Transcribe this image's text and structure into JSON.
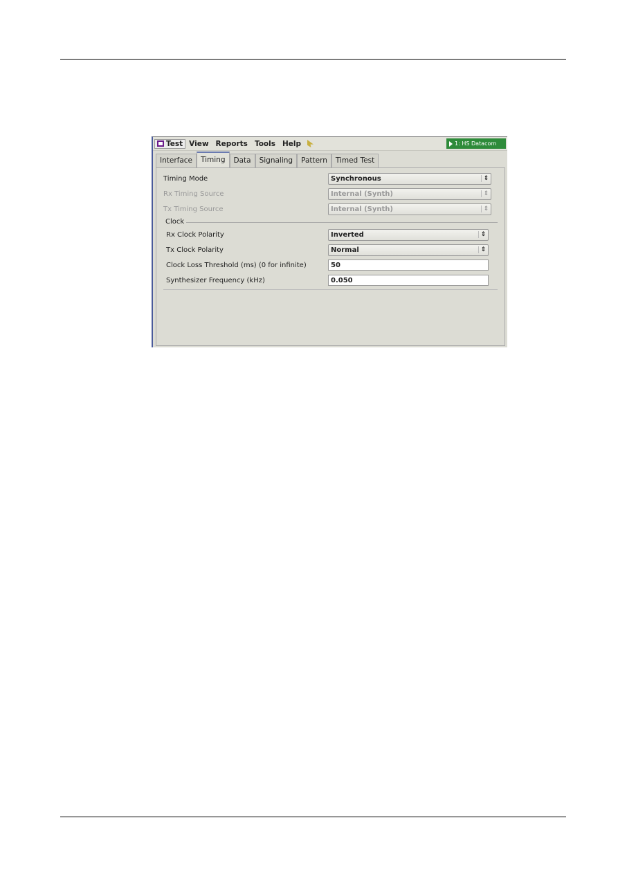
{
  "app": {
    "menu": [
      "Test",
      "View",
      "Reports",
      "Tools",
      "Help"
    ],
    "status": "1: HS Datacom",
    "tabs": [
      "Interface",
      "Timing",
      "Data",
      "Signaling",
      "Pattern",
      "Timed Test"
    ],
    "active_tab": "Timing",
    "fields": {
      "timing_mode": {
        "label": "Timing Mode",
        "value": "Synchronous"
      },
      "rx_timing_source": {
        "label": "Rx Timing Source",
        "value": "Internal (Synth)"
      },
      "tx_timing_source": {
        "label": "Tx Timing Source",
        "value": "Internal (Synth)"
      }
    },
    "clock": {
      "title": "Clock",
      "rx_polarity": {
        "label": "Rx Clock Polarity",
        "value": "Inverted"
      },
      "tx_polarity": {
        "label": "Tx Clock Polarity",
        "value": "Normal"
      },
      "loss_threshold": {
        "label": "Clock Loss Threshold (ms) (0 for infinite)",
        "value": "50"
      },
      "synth_freq": {
        "label": "Synthesizer Frequency (kHz)",
        "value": "0.050"
      }
    }
  }
}
